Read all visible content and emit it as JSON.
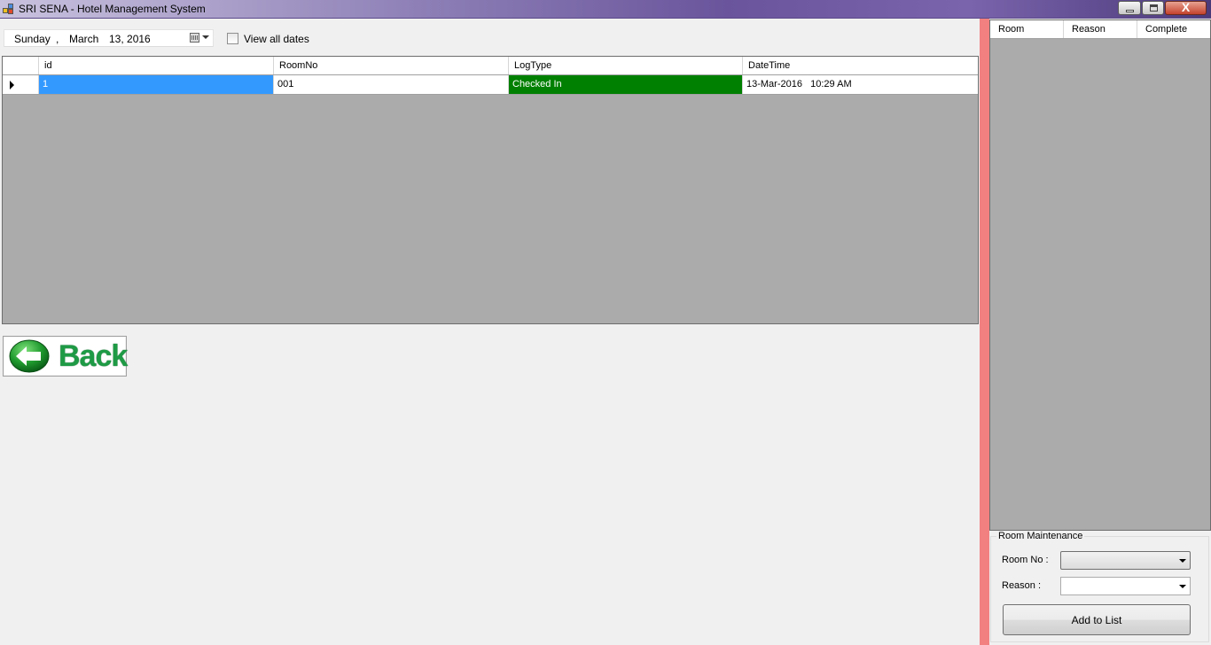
{
  "window": {
    "title": "SRI SENA - Hotel Management System",
    "close_glyph": "X"
  },
  "date_picker": {
    "weekday": "Sunday",
    "sep": ",",
    "month": "March",
    "day_year": "13, 2016"
  },
  "view_all": {
    "label": "View all dates",
    "checked": false
  },
  "log_grid": {
    "columns": [
      "id",
      "RoomNo",
      "LogType",
      "DateTime"
    ],
    "rows": [
      {
        "id": "1",
        "room_no": "001",
        "log_type": "Checked In",
        "date_time": "13-Mar-2016   10:29 AM"
      }
    ]
  },
  "back_button": {
    "label": "Back"
  },
  "maintenance_grid": {
    "columns": [
      "Room",
      "Reason",
      "Complete"
    ]
  },
  "room_maintenance": {
    "title": "Room Maintenance",
    "room_no_label": "Room No :",
    "reason_label": "Reason :",
    "room_no_value": "",
    "reason_value": "",
    "add_label": "Add to List"
  },
  "colors": {
    "selected_cell": "#3399ff",
    "checked_in": "#008000",
    "separator": "#f28080",
    "back_green": "#1e9a45"
  }
}
